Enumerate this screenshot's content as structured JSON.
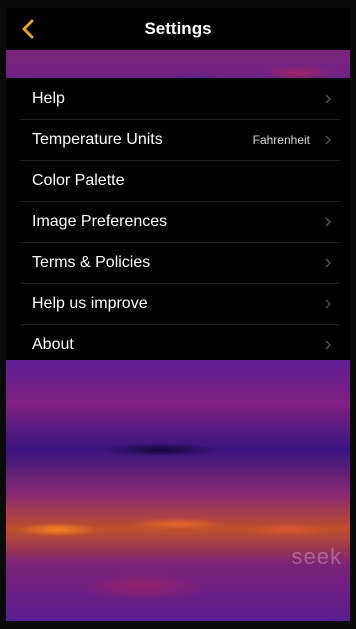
{
  "header": {
    "title": "Settings",
    "back_icon": "chevron-left-icon",
    "accent_color": "#e0a030"
  },
  "menu": {
    "items": [
      {
        "label": "Help",
        "value": "",
        "has_chevron": true
      },
      {
        "label": "Temperature Units",
        "value": "Fahrenheit",
        "has_chevron": true
      },
      {
        "label": "Color Palette",
        "value": "",
        "has_chevron": false
      },
      {
        "label": "Image Preferences",
        "value": "",
        "has_chevron": true
      },
      {
        "label": "Terms & Policies",
        "value": "",
        "has_chevron": true
      },
      {
        "label": "Help us improve",
        "value": "",
        "has_chevron": true
      },
      {
        "label": "About",
        "value": "",
        "has_chevron": true
      }
    ]
  },
  "watermark": {
    "text": "seek"
  }
}
